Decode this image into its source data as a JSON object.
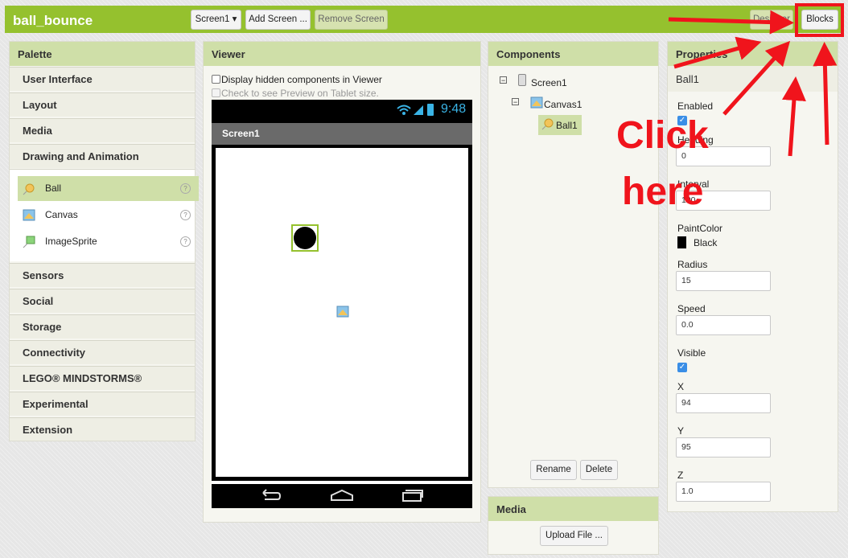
{
  "app": {
    "title": "ball_bounce"
  },
  "toolbar": {
    "screen_select": "Screen1 ▾",
    "add_screen": "Add Screen ...",
    "remove_screen": "Remove Screen",
    "designer": "Designer",
    "blocks": "Blocks"
  },
  "palette": {
    "title": "Palette",
    "categories_top": [
      "User Interface",
      "Layout",
      "Media",
      "Drawing and Animation"
    ],
    "items": [
      {
        "label": "Ball",
        "icon": "ball-icon"
      },
      {
        "label": "Canvas",
        "icon": "canvas-icon"
      },
      {
        "label": "ImageSprite",
        "icon": "imagesprite-icon"
      }
    ],
    "categories_bottom": [
      "Sensors",
      "Social",
      "Storage",
      "Connectivity",
      "LEGO® MINDSTORMS®",
      "Experimental",
      "Extension"
    ]
  },
  "viewer": {
    "title": "Viewer",
    "hidden_checkbox": "Display hidden components in Viewer",
    "tablet_checkbox": "Check to see Preview on Tablet size.",
    "status_time": "9:48",
    "screen_title": "Screen1"
  },
  "components": {
    "title": "Components",
    "tree": [
      "Screen1",
      "Canvas1",
      "Ball1"
    ],
    "rename": "Rename",
    "delete": "Delete"
  },
  "media": {
    "title": "Media",
    "upload": "Upload File ..."
  },
  "properties": {
    "title": "Properties",
    "component": "Ball1",
    "enabled": "Enabled",
    "heading_label": "Heading",
    "heading_value": "0",
    "interval_label": "Interval",
    "interval_value": "100",
    "paint_label": "PaintColor",
    "paint_value": "Black",
    "radius_label": "Radius",
    "radius_value": "15",
    "speed_label": "Speed",
    "speed_value": "0.0",
    "visible_label": "Visible",
    "x_label": "X",
    "x_value": "94",
    "y_label": "Y",
    "y_value": "95",
    "z_label": "Z",
    "z_value": "1.0"
  },
  "annotation": {
    "line1": "Click",
    "line2": "here",
    "color": "#f0141c"
  },
  "colors": {
    "accent": "#95c12e",
    "panel_header": "#cfdfa8",
    "selected": "#cfdfa8"
  }
}
